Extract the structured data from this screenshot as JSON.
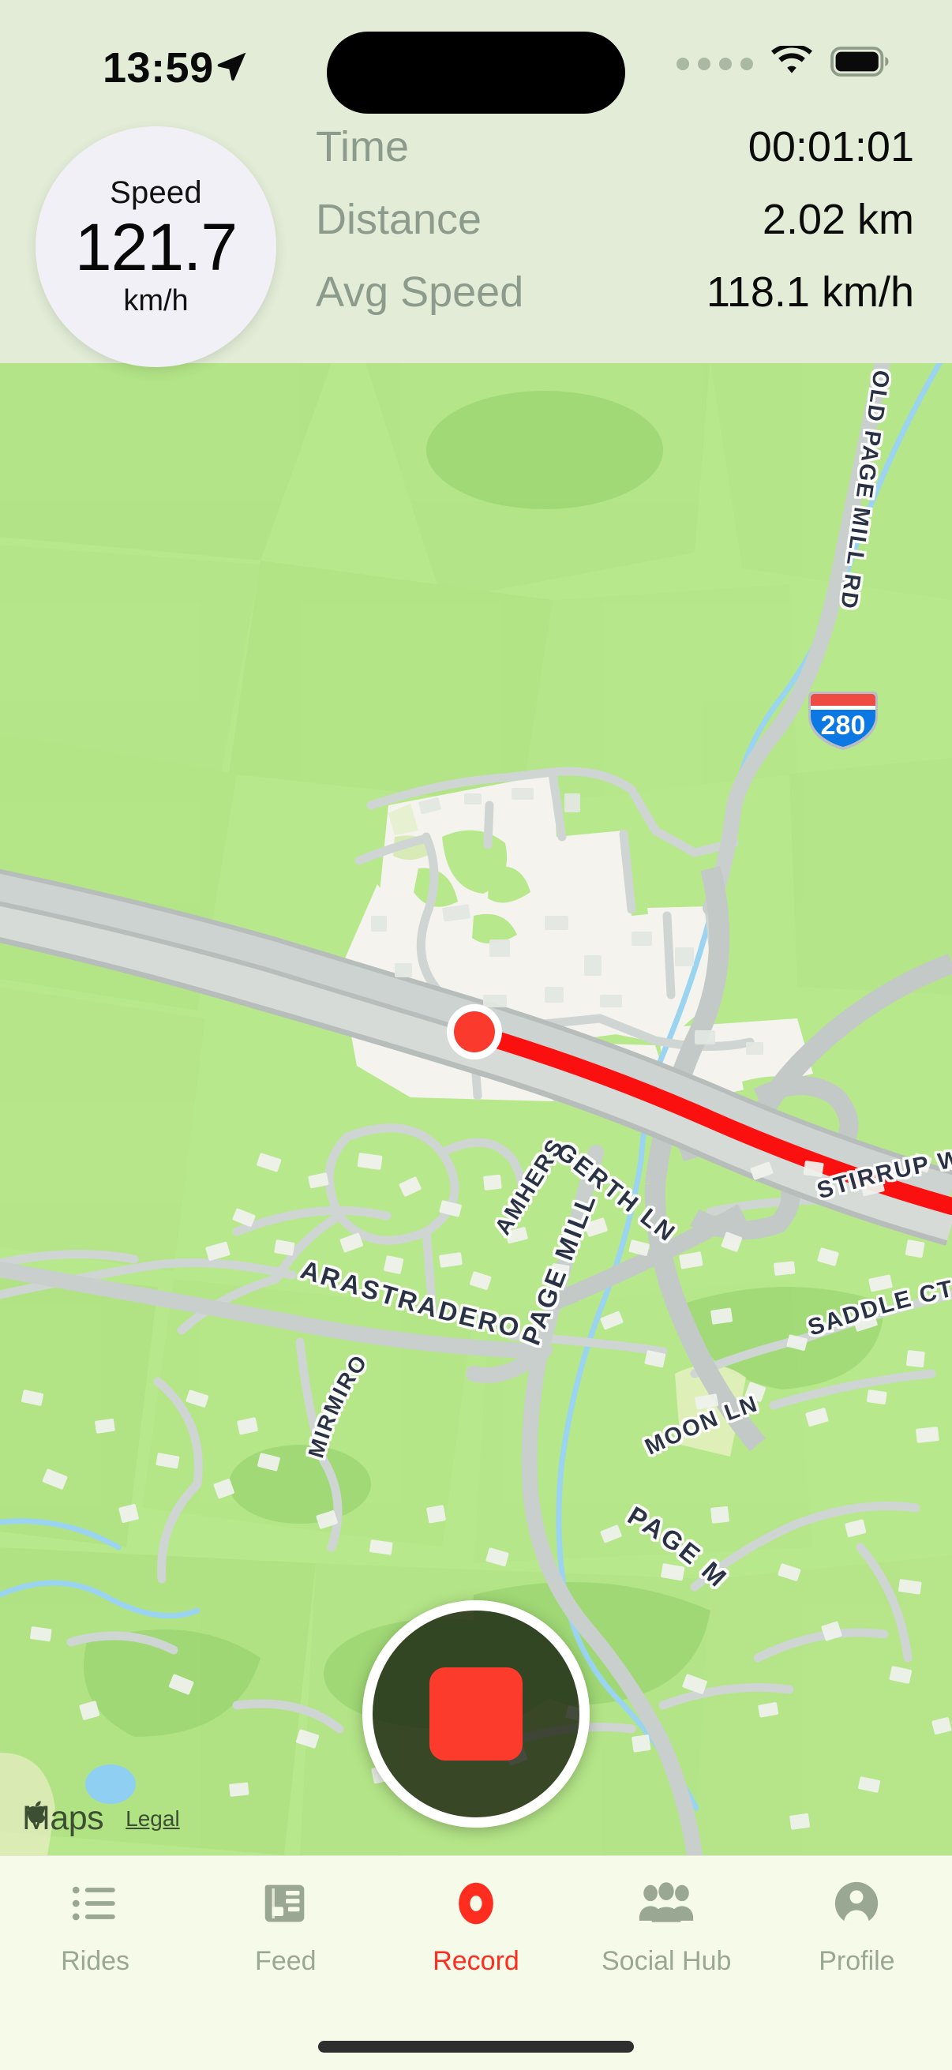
{
  "status_bar": {
    "time": "13:59",
    "location_arrow_icon": "location-arrow-icon",
    "signal_icon": "cellular-dots-icon",
    "wifi_icon": "wifi-icon",
    "battery_icon": "battery-full-icon"
  },
  "header": {
    "speed": {
      "label": "Speed",
      "value": "121.7",
      "unit": "km/h"
    },
    "stats": [
      {
        "label": "Time",
        "value": "00:01:01"
      },
      {
        "label": "Distance",
        "value": "2.02 km"
      },
      {
        "label": "Avg Speed",
        "value": "118.1 km/h"
      }
    ]
  },
  "map": {
    "attribution": {
      "brand": "Maps",
      "apple_logo_icon": "apple-logo-icon",
      "legal_link": "Legal"
    },
    "highway_shield": "280",
    "road_labels": [
      "OLD PAGE MILL RD",
      "GERTH LN",
      "STIRRUP WAY",
      "SADDLE CT",
      "AMHERST CT",
      "ARASTRADERO RD",
      "PAGE MILL RD",
      "MIRMIROU DR",
      "MOON LN",
      "PAGE MILL"
    ],
    "route_color": "#fb1010",
    "current_position_marker": "current-position-marker"
  },
  "stop_button": {
    "name": "stop-recording-button",
    "icon": "stop-square-icon",
    "color": "#fc3b2d"
  },
  "tabbar": {
    "items": [
      {
        "label": "Rides",
        "icon": "list-icon",
        "active": false
      },
      {
        "label": "Feed",
        "icon": "news-icon",
        "active": false
      },
      {
        "label": "Record",
        "icon": "record-icon",
        "active": true
      },
      {
        "label": "Social Hub",
        "icon": "people-icon",
        "active": false
      },
      {
        "label": "Profile",
        "icon": "person-icon",
        "active": false
      }
    ],
    "active_color": "#ff2d20",
    "inactive_color": "#9aa793"
  }
}
